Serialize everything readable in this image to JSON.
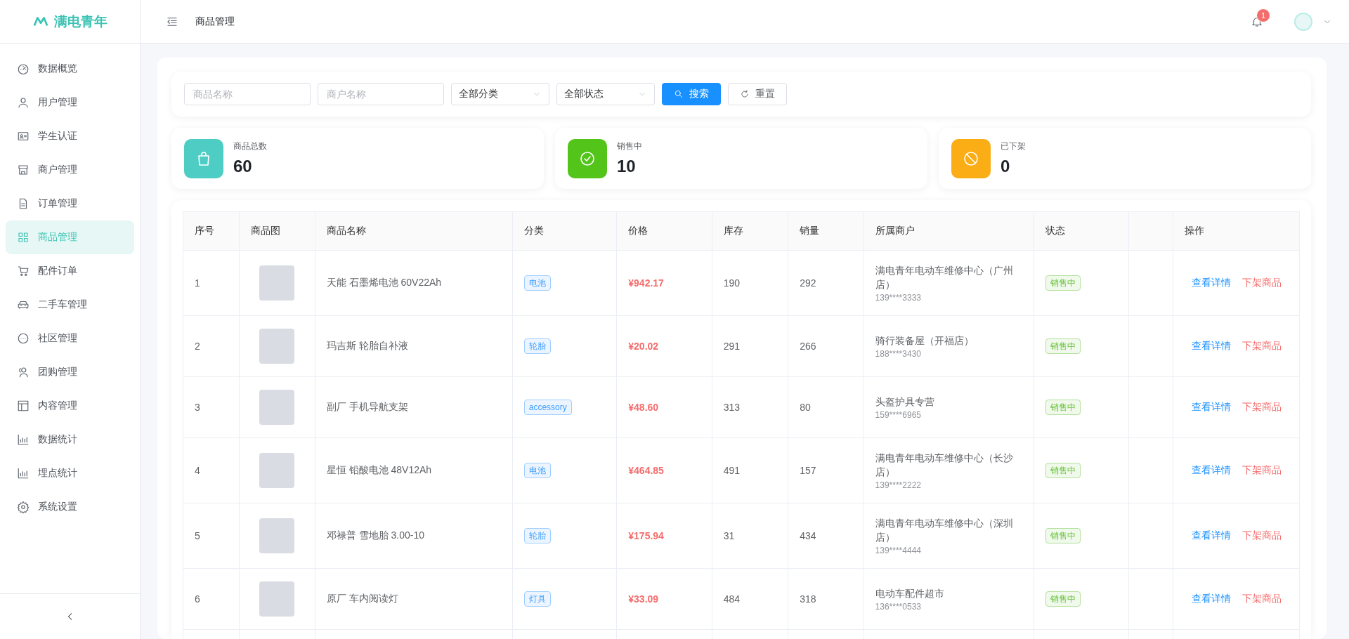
{
  "brand": {
    "name": "满电青年"
  },
  "sidebar": {
    "items": [
      {
        "label": "数据概览",
        "selected": false
      },
      {
        "label": "用户管理",
        "selected": false
      },
      {
        "label": "学生认证",
        "selected": false
      },
      {
        "label": "商户管理",
        "selected": false
      },
      {
        "label": "订单管理",
        "selected": false
      },
      {
        "label": "商品管理",
        "selected": true
      },
      {
        "label": "配件订单",
        "selected": false
      },
      {
        "label": "二手车管理",
        "selected": false
      },
      {
        "label": "社区管理",
        "selected": false
      },
      {
        "label": "团购管理",
        "selected": false
      },
      {
        "label": "内容管理",
        "selected": false
      },
      {
        "label": "数据统计",
        "selected": false
      },
      {
        "label": "埋点统计",
        "selected": false
      },
      {
        "label": "系统设置",
        "selected": false
      }
    ]
  },
  "header": {
    "title": "商品管理",
    "notification_count": "1"
  },
  "filters": {
    "product_name": {
      "placeholder": "商品名称"
    },
    "merchant_name": {
      "placeholder": "商户名称"
    },
    "category": {
      "value": "全部分类"
    },
    "status": {
      "value": "全部状态"
    },
    "buttons": [
      {
        "label": "搜索",
        "kind": "primary"
      },
      {
        "label": "重置",
        "kind": "default"
      }
    ]
  },
  "stats": [
    {
      "label": "商品总数",
      "value": "60",
      "color": "#4ecdc4",
      "kind": "bag"
    },
    {
      "label": "销售中",
      "value": "10",
      "color": "#52c41a",
      "kind": "check"
    },
    {
      "label": "已下架",
      "value": "0",
      "color": "#faad14",
      "kind": "ban"
    }
  ],
  "table": {
    "columns": [
      "序号",
      "商品图",
      "商品名称",
      "分类",
      "价格",
      "库存",
      "销量",
      "所属商户",
      "状态",
      "操作"
    ],
    "rows": [
      {
        "index": "1",
        "name": "天能 石墨烯电池 60V22Ah",
        "category": "电池",
        "price": "¥942.17",
        "stock": "190",
        "sales": "292",
        "merchant": "满电青年电动车维修中心（广州店）",
        "phone": "139****3333",
        "status": "销售中",
        "actions": [
          "查看详情",
          "下架商品"
        ]
      },
      {
        "index": "2",
        "name": "玛吉斯 轮胎自补液",
        "category": "轮胎",
        "price": "¥20.02",
        "stock": "291",
        "sales": "266",
        "merchant": "骑行装备屋（开福店）",
        "phone": "188****3430",
        "status": "销售中",
        "actions": [
          "查看详情",
          "下架商品"
        ]
      },
      {
        "index": "3",
        "name": "副厂 手机导航支架",
        "category": "accessory",
        "price": "¥48.60",
        "stock": "313",
        "sales": "80",
        "merchant": "头盔护具专营",
        "phone": "159****6965",
        "status": "销售中",
        "actions": [
          "查看详情",
          "下架商品"
        ]
      },
      {
        "index": "4",
        "name": "星恒 铅酸电池 48V12Ah",
        "category": "电池",
        "price": "¥464.85",
        "stock": "491",
        "sales": "157",
        "merchant": "满电青年电动车维修中心（长沙店）",
        "phone": "139****2222",
        "status": "销售中",
        "actions": [
          "查看详情",
          "下架商品"
        ]
      },
      {
        "index": "5",
        "name": "邓禄普 雪地胎 3.00-10",
        "category": "轮胎",
        "price": "¥175.94",
        "stock": "31",
        "sales": "434",
        "merchant": "满电青年电动车维修中心（深圳店）",
        "phone": "139****4444",
        "status": "销售中",
        "actions": [
          "查看详情",
          "下架商品"
        ]
      },
      {
        "index": "6",
        "name": "原厂 车内阅读灯",
        "category": "灯具",
        "price": "¥33.09",
        "stock": "484",
        "sales": "318",
        "merchant": "电动车配件超市",
        "phone": "136****0533",
        "status": "销售中",
        "actions": [
          "查看详情",
          "下架商品"
        ]
      }
    ]
  }
}
